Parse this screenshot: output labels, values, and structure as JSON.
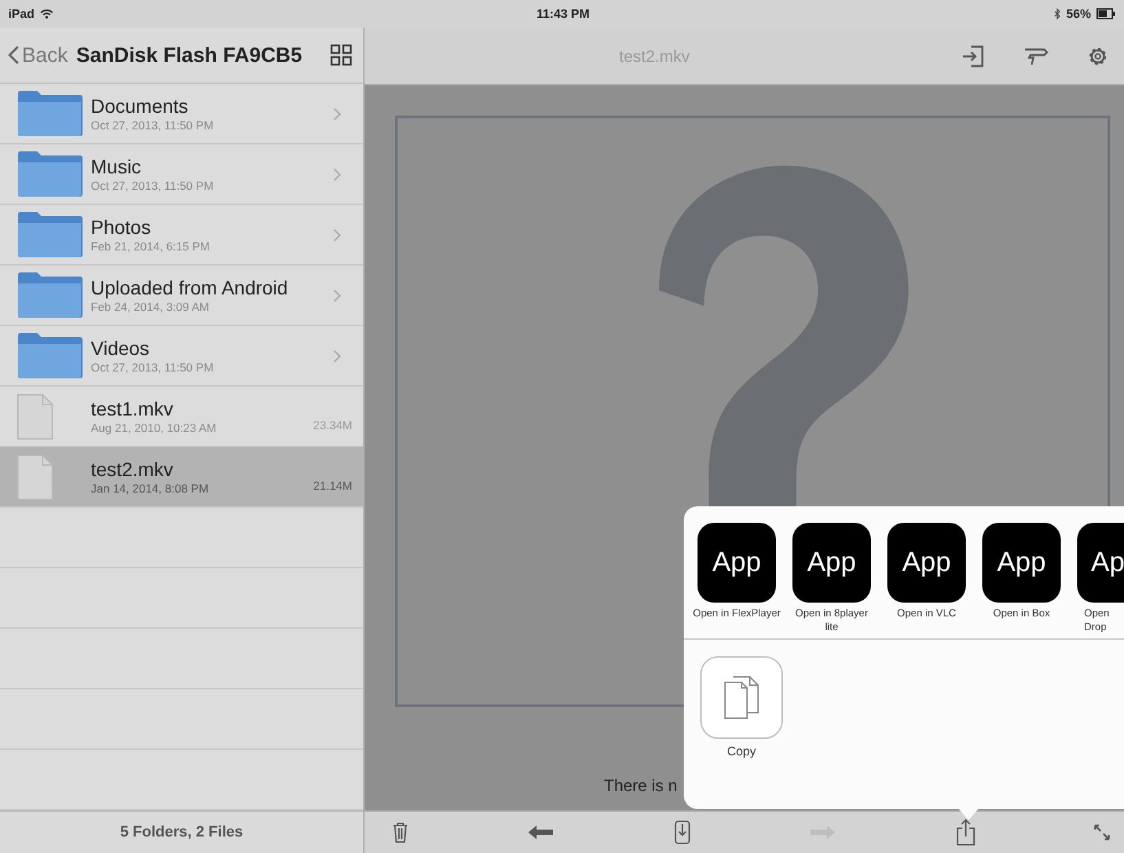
{
  "status_bar": {
    "carrier": "iPad",
    "time": "11:43 PM",
    "battery": "56%"
  },
  "nav_bar": {
    "back": "Back",
    "title": "SanDisk Flash FA9CB5",
    "viewer_title": "test2.mkv"
  },
  "files": [
    {
      "kind": "folder",
      "name": "Documents",
      "date": "Oct 27, 2013, 11:50 PM",
      "selected": false
    },
    {
      "kind": "folder",
      "name": "Music",
      "date": "Oct 27, 2013, 11:50 PM",
      "selected": false
    },
    {
      "kind": "folder",
      "name": "Photos",
      "date": "Feb 21, 2014, 6:15 PM",
      "selected": false
    },
    {
      "kind": "folder",
      "name": "Uploaded from Android",
      "date": "Feb 24, 2014, 3:09 AM",
      "selected": false
    },
    {
      "kind": "folder",
      "name": "Videos",
      "date": "Oct 27, 2013, 11:50 PM",
      "selected": false
    },
    {
      "kind": "file",
      "name": "test1.mkv",
      "date": "Aug 21, 2010, 10:23 AM",
      "size": "23.34M",
      "selected": false
    },
    {
      "kind": "file",
      "name": "test2.mkv",
      "date": "Jan 14, 2014, 8:08 PM",
      "size": "21.14M",
      "selected": true
    }
  ],
  "footer": "5 Folders, 2 Files",
  "viewer": {
    "message": "There is n"
  },
  "share_sheet": {
    "apps": [
      {
        "kind": "full",
        "icon_text": "App",
        "label": "Open in FlexPlayer"
      },
      {
        "kind": "full",
        "icon_text": "App",
        "label": "Open in 8player lite"
      },
      {
        "kind": "full",
        "icon_text": "App",
        "label": "Open in VLC"
      },
      {
        "kind": "full",
        "icon_text": "App",
        "label": "Open in Box"
      },
      {
        "kind": "partial",
        "icon_text": "Ap",
        "label": "Open Drop"
      }
    ],
    "actions": [
      {
        "label": "Copy"
      }
    ]
  },
  "toolbar": [
    {
      "kind": "trash",
      "disabled": false
    },
    {
      "kind": "back",
      "disabled": false
    },
    {
      "kind": "save",
      "disabled": false
    },
    {
      "kind": "forward",
      "disabled": true
    },
    {
      "kind": "share",
      "disabled": false
    },
    {
      "kind": "expand",
      "disabled": false
    }
  ]
}
